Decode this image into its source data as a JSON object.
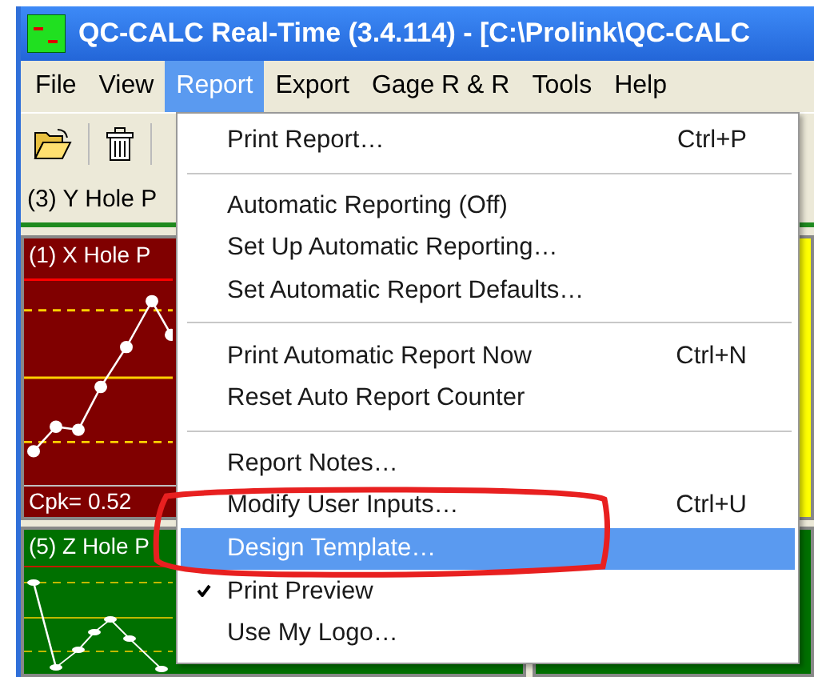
{
  "window": {
    "title": "QC-CALC Real-Time (3.4.114)  - [C:\\Prolink\\QC-CALC"
  },
  "menu_bar": [
    {
      "label": "File",
      "selected": false
    },
    {
      "label": "View",
      "selected": false
    },
    {
      "label": "Report",
      "selected": true
    },
    {
      "label": "Export",
      "selected": false
    },
    {
      "label": "Gage R & R",
      "selected": false
    },
    {
      "label": "Tools",
      "selected": false
    },
    {
      "label": "Help",
      "selected": false
    }
  ],
  "chart_header": "(3) Y Hole P",
  "panels": [
    {
      "title": "(1) X Hole P",
      "footer": "Cpk= 0.52",
      "color": "#800000"
    },
    {
      "title": "(5) Z Hole P",
      "color": "#007000"
    }
  ],
  "side_panels": [
    {
      "color": "#ffff00"
    },
    {
      "color": "#007000"
    }
  ],
  "report_menu": [
    {
      "kind": "item",
      "label": "Print Report…",
      "shortcut": "Ctrl+P",
      "selected": false,
      "checked": false
    },
    {
      "kind": "separator"
    },
    {
      "kind": "item",
      "label": "Automatic Reporting (Off)",
      "selected": false,
      "checked": false
    },
    {
      "kind": "item",
      "label": "Set Up Automatic Reporting…",
      "selected": false,
      "checked": false
    },
    {
      "kind": "item",
      "label": "Set Automatic Report Defaults…",
      "selected": false,
      "checked": false
    },
    {
      "kind": "separator"
    },
    {
      "kind": "item",
      "label": "Print Automatic Report Now",
      "shortcut": "Ctrl+N",
      "selected": false,
      "checked": false
    },
    {
      "kind": "item",
      "label": "Reset Auto Report Counter",
      "selected": false,
      "checked": false
    },
    {
      "kind": "separator"
    },
    {
      "kind": "item",
      "label": "Report Notes…",
      "selected": false,
      "checked": false
    },
    {
      "kind": "item",
      "label": "Modify User Inputs…",
      "shortcut": "Ctrl+U",
      "selected": false,
      "checked": false
    },
    {
      "kind": "item",
      "label": "Design Template…",
      "selected": true,
      "checked": false
    },
    {
      "kind": "item",
      "label": "Print Preview",
      "selected": false,
      "checked": true
    },
    {
      "kind": "item",
      "label": "Use My Logo…",
      "selected": false,
      "checked": false
    }
  ],
  "annotation": {
    "kind": "ellipse"
  }
}
